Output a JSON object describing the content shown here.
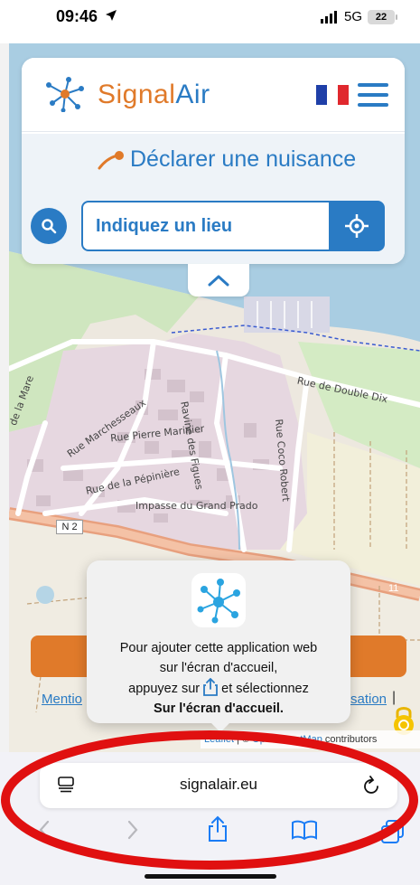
{
  "status_bar": {
    "time": "09:46",
    "network": "5G",
    "battery": "22"
  },
  "app": {
    "logo_signal": "Signal",
    "logo_air": "Air",
    "declare_label": "Déclarer une nuisance",
    "search_placeholder": "Indiquez un lieu"
  },
  "map": {
    "streets": {
      "double_dix": "Rue de Double Dix",
      "ravine": "Ravine des Figues",
      "coco_robert": "Rue Coco Robert",
      "marchesseaux": "Rue Marchesseaux",
      "pierre_mariner": "Rue Pierre Marinier",
      "pepiniere": "Rue de la Pépinière",
      "grand_prado": "Impasse du Grand Prado",
      "mare": "de la Mare",
      "n2": "N 2",
      "road_11": "11"
    },
    "attribution_leaflet": "Leaflet",
    "attribution_sep": " | © ",
    "attribution_osm": "OpenStreetMap",
    "attribution_contrib": " contributors",
    "mentions_link": "Mentio",
    "sation_link": "sation",
    "pipe": "|"
  },
  "tooltip": {
    "line1": "Pour ajouter cette application web",
    "line2": "sur l'écran d'accueil,",
    "line3a": "appuyez sur",
    "line3b": "et sélectionnez",
    "line4": "Sur l'écran d'accueil."
  },
  "safari": {
    "url": "signalair.eu"
  },
  "colors": {
    "brand_blue": "#2a7bc4",
    "brand_orange": "#e07a2a",
    "annotation_red": "#e01010"
  }
}
